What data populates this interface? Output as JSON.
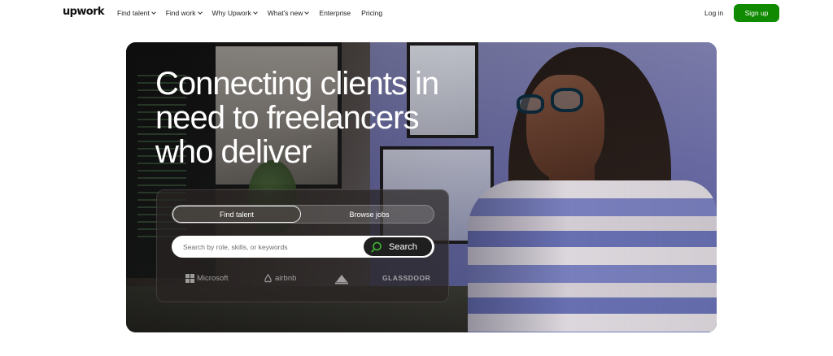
{
  "header": {
    "logo": "upwork",
    "nav": [
      {
        "label": "Find talent",
        "dropdown": true
      },
      {
        "label": "Find work",
        "dropdown": true
      },
      {
        "label": "Why Upwork",
        "dropdown": true
      },
      {
        "label": "What's new",
        "dropdown": true
      },
      {
        "label": "Enterprise",
        "dropdown": false
      },
      {
        "label": "Pricing",
        "dropdown": false
      }
    ],
    "login": "Log in",
    "signup": "Sign up"
  },
  "hero": {
    "headline": "Connecting clients in need to freelancers who deliver",
    "toggle": {
      "find_talent": "Find talent",
      "browse_jobs": "Browse jobs",
      "selected": "Find talent"
    },
    "search": {
      "placeholder": "Search by role, skills, or keywords",
      "value": "",
      "button": "Search"
    },
    "clients": [
      "Microsoft",
      "airbnb",
      "",
      "GLASSDOOR"
    ]
  },
  "colors": {
    "brand_green": "#108a00",
    "dark": "#1f1f1f"
  },
  "icons": [
    "chevron-down-icon",
    "search-icon",
    "microsoft-logo-icon",
    "airbnb-logo-icon",
    "bissell-logo-icon"
  ]
}
